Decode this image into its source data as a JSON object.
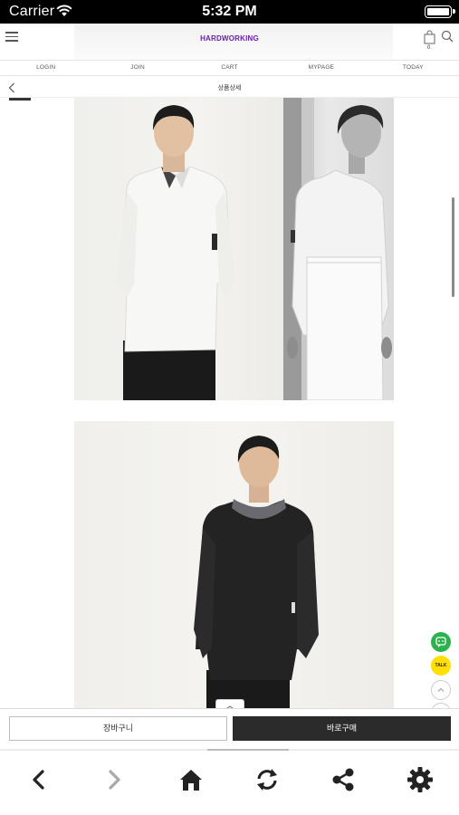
{
  "status_bar": {
    "carrier": "Carrier",
    "time": "5:32 PM"
  },
  "header": {
    "logo": "HARDWORKING",
    "cart_count": "0"
  },
  "nav": {
    "items": [
      "LOGIN",
      "JOIN",
      "CART",
      "MYPAGE",
      "TODAY"
    ]
  },
  "subheader": {
    "title": "상품상세"
  },
  "product_images": [
    {
      "alt": "white chef jacket front"
    },
    {
      "alt": "white chef jacket with apron"
    },
    {
      "alt": "black chef jacket with grey collar"
    }
  ],
  "buy_bar": {
    "cart_label": "장바구니",
    "buy_label": "바로구매"
  },
  "floating": {
    "kakao_label": "TALK"
  },
  "toolbar": {
    "icons": [
      "back-icon",
      "forward-icon",
      "home-icon",
      "refresh-icon",
      "share-icon",
      "settings-icon"
    ]
  },
  "colors": {
    "logo": "#6a1fb3",
    "buy_button": "#2b2b2b",
    "talk": "#2bb24c",
    "kakao": "#ffe000"
  }
}
